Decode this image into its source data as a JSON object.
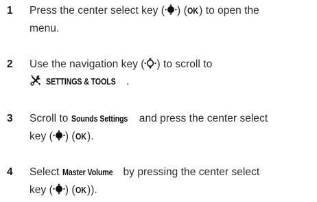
{
  "steps": [
    {
      "number": "1",
      "t1": "Press the center select key (",
      "t2": ") (",
      "k1": "OK",
      "t3": ") to open the",
      "line2": "menu."
    },
    {
      "number": "2",
      "t1": "Use the navigation key (",
      "t2": ") to scroll to",
      "k1": "SETTINGS & TOOLS",
      "t3": "."
    },
    {
      "number": "3",
      "t1": "Scroll to ",
      "k1": "Sounds Settings",
      "t2": " and press the center select",
      "t3": "key (",
      "t4": ") (",
      "k2": "OK",
      "t5": ")."
    },
    {
      "number": "4",
      "t1": "Select ",
      "k1": "Master Volume",
      "t2": " by pressing the center select",
      "t3": "key (",
      "t4": ") (",
      "k2": "OK",
      "t5": "))."
    }
  ],
  "icons": {
    "select_key": "center-select-key-icon",
    "nav_key": "navigation-key-icon",
    "tools": "settings-tools-icon"
  }
}
